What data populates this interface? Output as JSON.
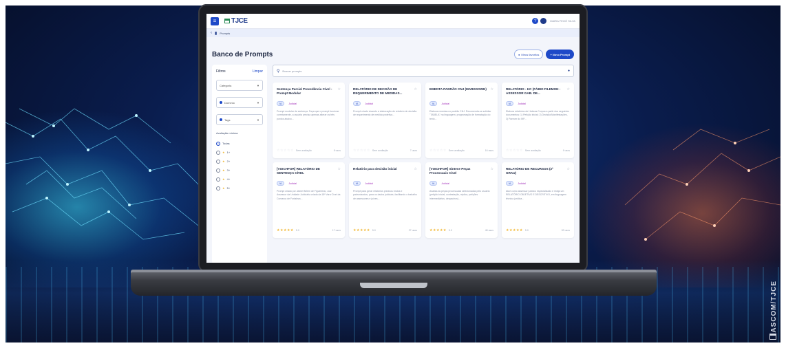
{
  "app": {
    "logo_text": "TJCE",
    "user_name": "MARIA FEIJÓ SILVA",
    "breadcrumb": "Prompts",
    "page_title": "Banco de Prompts",
    "my_favorites_label": "Meus favoritos",
    "new_prompt_label": "+ Novo Prompt"
  },
  "filters": {
    "title": "Filtros",
    "clear_label": "Limpar",
    "category_placeholder": "Categoria",
    "domain_placeholder": "Domínio",
    "tags_placeholder": "Tags",
    "rating_label": "Avaliação mínima",
    "rating_options": [
      "Todas",
      "1+",
      "2+",
      "3+",
      "4+",
      "5+"
    ]
  },
  "search": {
    "placeholder": "Buscar prompts"
  },
  "cards": [
    {
      "title": "Sentença Parcial Procedência Cível - Prompt Modular",
      "chip1": "IA",
      "chip2": "Judicial",
      "desc": "Prompt modular de sentença. Faça que o prompt funcione corretamente, a usuária precisa apenas alterar os três pontos abaixo...",
      "rating": "Sem avaliação",
      "uses": "8 usos",
      "stars": "☆☆☆☆☆"
    },
    {
      "title": "RELATÓRIO DE DECISÃO DE REQUERIMENTO DE MEDIDAS...",
      "chip1": "IA",
      "chip2": "Judicial",
      "desc": "Prompt criado visando a elaboração de relatório de decisão de requerimento de medida protetiva...",
      "rating": "Sem avaliação",
      "uses": "7 usos",
      "stars": "☆☆☆☆☆"
    },
    {
      "title": "EMENTA PADRÃO CNJ (MARKDOWN)",
      "chip1": "IA",
      "chip2": "Judicial",
      "desc": "Elabora ementas no padrão CNJ. Recomenda-se solicitar \"TABELA\" na linguagem, programação de formatação do texto...",
      "rating": "Sem avaliação",
      "uses": "16 usos",
      "stars": "☆☆☆☆☆"
    },
    {
      "title": "RELATÓRIO - HC (FÁBIO FILEMON - ASSESSOR GAB. DE...",
      "chip1": "IA",
      "chip2": "Judicial",
      "desc": "Elabora relatórios de Habeas Corpus a partir dos seguintes documentos: 1) Petição inicial; 2) Decisão/Manifestações, 3) Parecer do MP...",
      "rating": "Sem avaliação",
      "uses": "9 usos",
      "stars": "☆☆☆☆☆"
    },
    {
      "title": "[VOICHFOR] RELATÓRIO DE SENTENÇA CÍVEL",
      "chip1": "IA",
      "chip2": "Judicial",
      "desc": "Prompt criado por Jaime Belém de Figueiredo, Juiz Assessor da Unidade Judiciária criada da 18ª Vara Cível da Comarca de Fortaleza...",
      "rating": "5.0",
      "uses": "17 usos",
      "stars": "★★★★★"
    },
    {
      "title": "Relatório para decisão inicial",
      "chip1": "IA",
      "chip2": "Judicial",
      "desc": "Prompt para gerar relatórios precisos brutos e padronizados, para os dados judiciais, facilitando o trabalho de assessores e juízes...",
      "rating": "5.0",
      "uses": "27 usos",
      "stars": "★★★★★"
    },
    {
      "title": "[VOICHFOR] Síntese Peças Processuais Cível",
      "chip1": "IA",
      "chip2": "Judicial",
      "desc": "Analisa as peças processuais selecionadas pelo usuário (petição inicial, contestação, réplica, petições intermediárias, despachos)...",
      "rating": "5.0",
      "uses": "48 usos",
      "stars": "★★★★★"
    },
    {
      "title": "RELATÓRIO DE RECURSOS (2º GRAU)",
      "chip1": "IA",
      "chip2": "Judicial",
      "desc": "Atue como assessor jurídico especializado e redija um RELATÓRIO OBJETIVO E DESCRITIVO, em linguagem técnica jurídica...",
      "rating": "5.0",
      "uses": "53 usos",
      "stars": "★★★★★"
    }
  ],
  "credit": "ASCOM/TJCE",
  "colors": {
    "primary": "#1e49c8",
    "navy": "#1e3a8a",
    "background": "#f3f5fb",
    "star": "#f0b429"
  }
}
